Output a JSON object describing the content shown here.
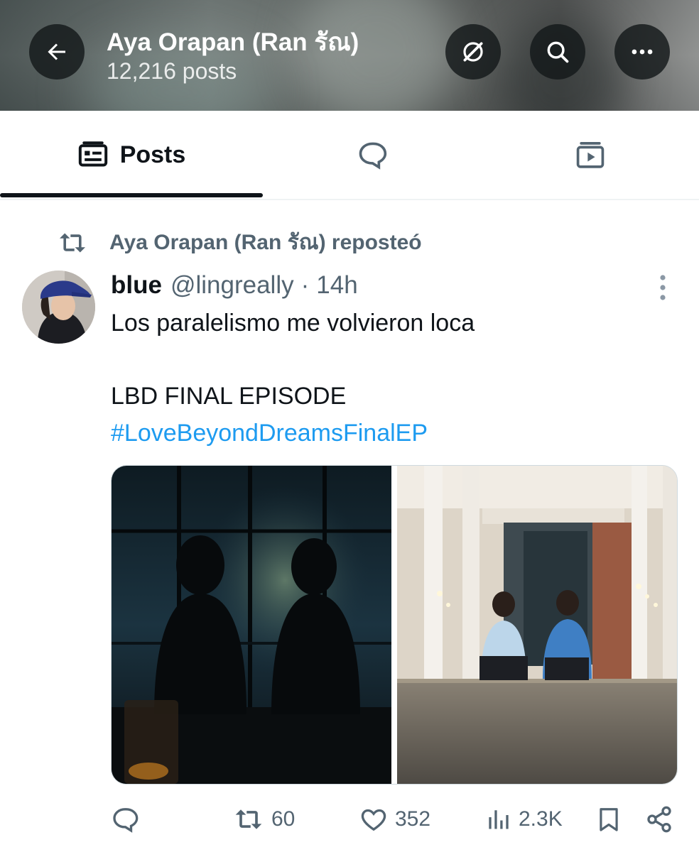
{
  "header": {
    "title": "Aya Orapan (Ran รัณ)",
    "post_count": "12,216 posts",
    "icons": {
      "back": "arrow-left-icon",
      "grok": "grok-icon",
      "search": "search-icon",
      "more": "more-horizontal-icon"
    }
  },
  "tabs": [
    {
      "label": "Posts",
      "icon": "posts-icon",
      "selected": true
    },
    {
      "label": "",
      "icon": "replies-icon",
      "selected": false
    },
    {
      "label": "",
      "icon": "media-icon",
      "selected": false
    }
  ],
  "repost": {
    "text": "Aya Orapan (Ran รัณ) reposteó",
    "icon": "repost-icon"
  },
  "tweet": {
    "display_name": "blue",
    "handle": "@lingreally",
    "separator": "·",
    "time": "14h",
    "text_lines": [
      "Los paralelismo me volvieron loca",
      "LBD FINAL EPISODE"
    ],
    "hashtag": "#LoveBeyondDreamsFinalEP",
    "media_count": 2
  },
  "actions": {
    "reply": {
      "icon": "reply-icon",
      "count": ""
    },
    "repost": {
      "icon": "repost-icon",
      "count": "60"
    },
    "like": {
      "icon": "heart-icon",
      "count": "352"
    },
    "views": {
      "icon": "views-icon",
      "count": "2.3K"
    },
    "bookmark": {
      "icon": "bookmark-icon",
      "count": ""
    },
    "share": {
      "icon": "share-icon",
      "count": ""
    }
  },
  "colors": {
    "text_primary": "#0f1419",
    "text_secondary": "#536471",
    "link": "#1d9bf0"
  }
}
